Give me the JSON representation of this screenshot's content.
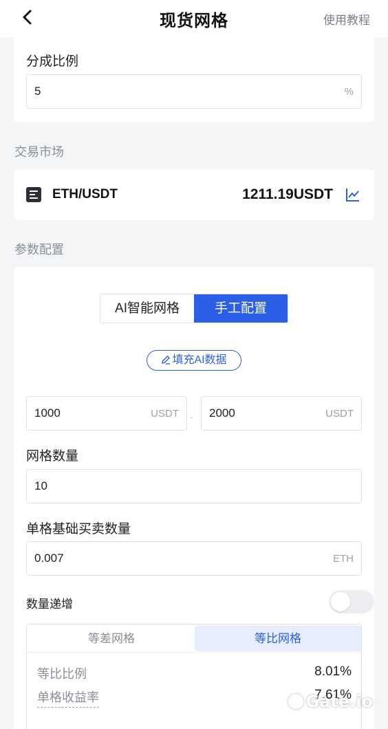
{
  "header": {
    "title": "现货网格",
    "tutorial_label": "使用教程"
  },
  "split_ratio": {
    "label": "分成比例",
    "value": "5",
    "unit": "%"
  },
  "market": {
    "section_title": "交易市场",
    "pair": "ETH/USDT",
    "price": "1211.19USDT"
  },
  "params": {
    "section_title": "参数配置",
    "mode_tabs": [
      "AI智能网格",
      "手工配置"
    ],
    "active_mode": "手工配置",
    "fill_ai_label": "填充AI数据",
    "price_low": {
      "value": "1000",
      "unit": "USDT"
    },
    "price_separator": "-",
    "price_high": {
      "value": "2000",
      "unit": "USDT"
    },
    "grid_count": {
      "label": "网格数量",
      "value": "10"
    },
    "base_amount": {
      "label": "单格基础买卖数量",
      "value": "0.007",
      "unit": "ETH"
    },
    "increment": {
      "label": "数量递增",
      "enabled": false
    },
    "grid_type_tabs": [
      "等差网格",
      "等比网格"
    ],
    "active_grid_type": "等比网格",
    "ratio": {
      "label": "等比比例",
      "value": "8.01%"
    },
    "profit_rate": {
      "label": "单格收益率",
      "value": "7.61%"
    }
  },
  "watermark": "Gate.io",
  "colors": {
    "accent": "#2a5fe6",
    "background": "#f4f5f7"
  }
}
